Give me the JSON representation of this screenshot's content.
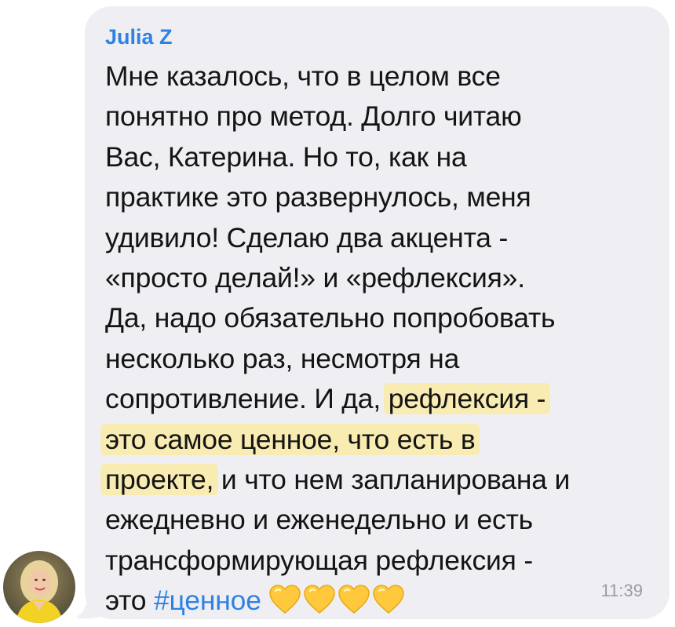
{
  "message": {
    "sender": "Julia Z",
    "lines": [
      "Мне казалось, что в целом все",
      "понятно про метод. Долго читаю",
      "Вас, Катерина. Но то, как на",
      "практике это развернулось, меня",
      "удивило! Сделаю два акцента -",
      "«просто делай!» и «рефлексия».",
      "Да, надо обязательно попробовать",
      "несколько раз, несмотря на"
    ],
    "line9_plain": "сопротивление. И да, ",
    "line9_highlight": "рефлексия -",
    "line10_highlight": "это самое ценное, что есть в",
    "line11_highlight": "проекте,",
    "line11_plain": " и что нем запланирована и",
    "line12": "ежедневно и еженедельно и есть",
    "line13": "трансформирующая рефлексия -",
    "line14_plain": "это ",
    "hashtag": "#ценное",
    "hearts": [
      "yellow-heart-icon",
      "yellow-heart-icon",
      "yellow-heart-icon",
      "yellow-heart-icon"
    ],
    "time": "11:39"
  },
  "colors": {
    "bubble": "#efeff3",
    "sender": "#2f82e4",
    "highlight": "#f8ecb2",
    "hashtag": "#2f82e4",
    "time": "#9a9aa0",
    "heart": "#ffc83d"
  }
}
